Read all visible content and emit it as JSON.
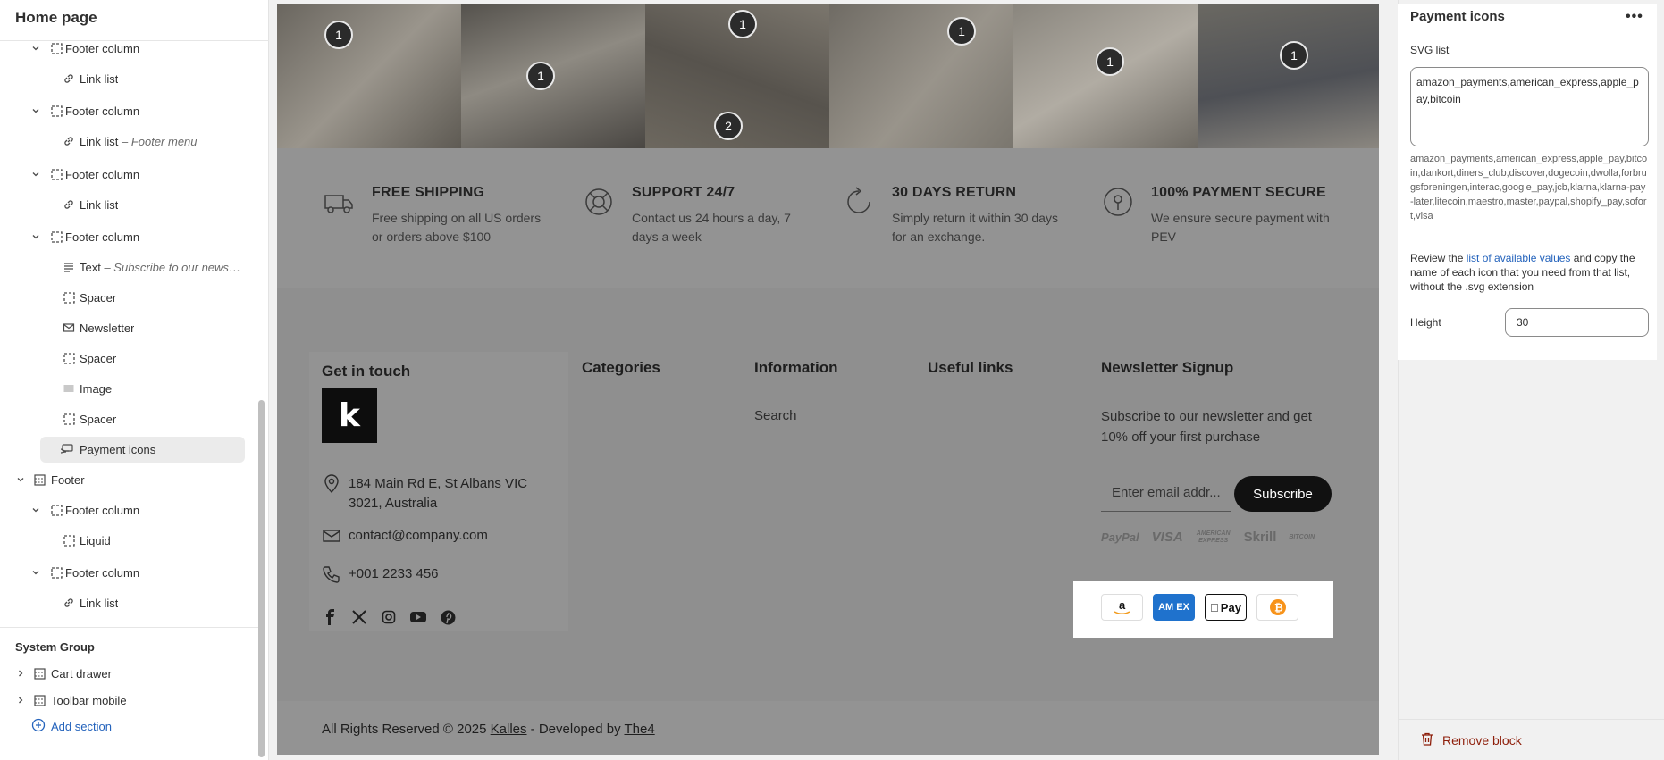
{
  "sidebar": {
    "title": "Home page",
    "rows": [
      {
        "label": "Footer column",
        "sub": ""
      },
      {
        "label": "Link list",
        "sub": ""
      },
      {
        "label": "Footer column",
        "sub": ""
      },
      {
        "label": "Link list",
        "sub": " – Footer menu"
      },
      {
        "label": "Footer column",
        "sub": ""
      },
      {
        "label": "Link list",
        "sub": ""
      },
      {
        "label": "Footer column",
        "sub": ""
      },
      {
        "label": "Text",
        "sub": " – Subscribe to our newsl..."
      },
      {
        "label": "Spacer",
        "sub": ""
      },
      {
        "label": "Newsletter",
        "sub": ""
      },
      {
        "label": "Spacer",
        "sub": ""
      },
      {
        "label": "Image",
        "sub": ""
      },
      {
        "label": "Spacer",
        "sub": ""
      },
      {
        "label": "Payment icons",
        "sub": ""
      },
      {
        "label": "Footer",
        "sub": ""
      },
      {
        "label": "Footer column",
        "sub": ""
      },
      {
        "label": "Liquid",
        "sub": ""
      },
      {
        "label": "Footer column",
        "sub": ""
      },
      {
        "label": "Link list",
        "sub": ""
      }
    ],
    "system_group": "System Group",
    "system_items": [
      "Cart drawer",
      "Toolbar mobile"
    ],
    "add_section": "Add section"
  },
  "preview": {
    "hotspots": [
      "1",
      "1",
      "2",
      "1",
      "1",
      "1",
      "1"
    ],
    "features": [
      {
        "title": "FREE SHIPPING",
        "desc": "Free shipping on all US orders or orders above $100",
        "icon": "truck-icon"
      },
      {
        "title": "SUPPORT 24/7",
        "desc": "Contact us 24 hours a day, 7 days a week",
        "icon": "lifebuoy-icon"
      },
      {
        "title": "30 DAYS RETURN",
        "desc": "Simply return it within 30 days for an exchange.",
        "icon": "return-icon"
      },
      {
        "title": "100% PAYMENT SECURE",
        "desc": "We ensure secure payment with PEV",
        "icon": "lock-icon"
      }
    ],
    "get_in_touch": "Get in touch",
    "logo_letter": "k",
    "address": "184 Main Rd E, St Albans VIC 3021, Australia",
    "email": "contact@company.com",
    "phone": "+001 2233 456",
    "columns": [
      "Categories",
      "Information",
      "Useful links",
      "Newsletter Signup"
    ],
    "info_link": "Search",
    "newsletter_desc": "Subscribe to our newsletter and get 10% off your first purchase",
    "newsletter_placeholder": "Enter email addr...",
    "subscribe_label": "Subscribe",
    "faint_payments": [
      "PayPal",
      "VISA",
      "AMERICAN EXPRESS",
      "Skrill",
      "BITCOIN"
    ],
    "payment_icons": [
      "amazon",
      "amex",
      "apple-pay",
      "bitcoin"
    ],
    "applepay_text": "Pay",
    "amex_text": "AM EX",
    "copyright_prefix": "All Rights Reserved © 2025 ",
    "copyright_brand": "Kalles",
    "copyright_mid": " - Developed by ",
    "copyright_dev": "The4"
  },
  "panel": {
    "title": "Payment icons",
    "svg_label": "SVG list",
    "svg_value": "amazon_payments,american_express,apple_pay,bitcoin",
    "svg_help": "amazon_payments,american_express,apple_pay,bitcoin,dankort,diners_club,discover,dogecoin,dwolla,forbrugsforeningen,interac,google_pay,jcb,klarna,klarna-pay-later,litecoin,maestro,master,paypal,shopify_pay,sofort,visa",
    "review_prefix": "Review the ",
    "review_link": "list of available values",
    "review_suffix": " and copy the name of each icon that you need from that list, without the .svg extension",
    "height_label": "Height",
    "height_value": "30",
    "remove_block": "Remove block"
  },
  "colors": {
    "accent": "#2463bc",
    "danger": "#8e1f0b",
    "amex": "#1f72cd",
    "bitcoin": "#f7931a"
  }
}
